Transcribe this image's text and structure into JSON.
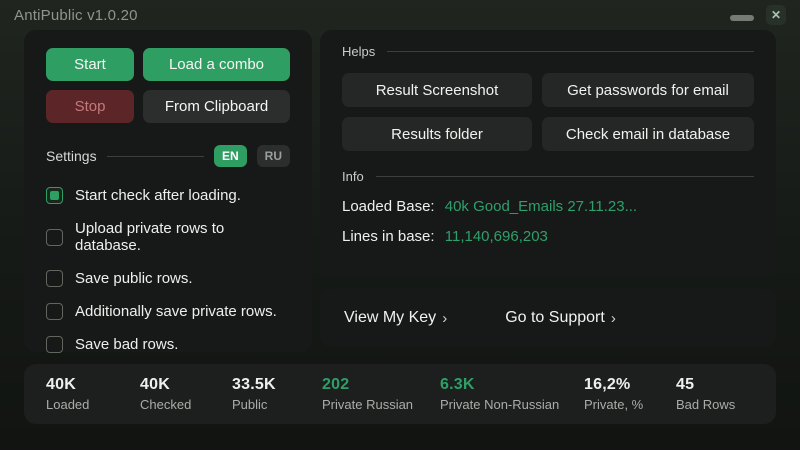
{
  "window": {
    "title": "AntiPublic v1.0.20",
    "close_glyph": "✕"
  },
  "left_panel": {
    "buttons": {
      "start": "Start",
      "load_combo": "Load a combo",
      "stop": "Stop",
      "from_clipboard": "From Clipboard"
    },
    "settings": {
      "label": "Settings",
      "languages": [
        {
          "code": "EN",
          "active": true
        },
        {
          "code": "RU",
          "active": false
        }
      ]
    },
    "checkboxes": [
      {
        "label": "Start check after loading.",
        "checked": true
      },
      {
        "label": "Upload private rows to database.",
        "checked": false
      },
      {
        "label": "Save public rows.",
        "checked": false
      },
      {
        "label": "Additionally save private rows.",
        "checked": false
      },
      {
        "label": "Save bad rows.",
        "checked": false
      }
    ]
  },
  "right_panel": {
    "helps": {
      "title": "Helps",
      "buttons": [
        "Result Screenshot",
        "Get passwords for email",
        "Results folder",
        "Check email in database"
      ]
    },
    "info": {
      "title": "Info",
      "rows": [
        {
          "label": "Loaded Base:",
          "value": "40k Good_Emails 27.11.23..."
        },
        {
          "label": "Lines in base:",
          "value": "11,140,696,203"
        }
      ]
    },
    "links": [
      {
        "label": "View My Key",
        "chevron": "›"
      },
      {
        "label": "Go to Support",
        "chevron": "›"
      }
    ]
  },
  "stats": [
    {
      "value": "40K",
      "label": "Loaded",
      "color": "white"
    },
    {
      "value": "40K",
      "label": "Checked",
      "color": "white"
    },
    {
      "value": "33.5K",
      "label": "Public",
      "color": "white"
    },
    {
      "value": "202",
      "label": "Private Russian",
      "color": "green"
    },
    {
      "value": "6.3K",
      "label": "Private Non-Russian",
      "color": "green"
    },
    {
      "value": "16,2%",
      "label": "Private, %",
      "color": "white"
    },
    {
      "value": "45",
      "label": "Bad Rows",
      "color": "white"
    }
  ],
  "colors": {
    "accent_green": "#2f9e63",
    "green_text": "#2f9f6b",
    "stop_bg": "#5c2628",
    "stop_text": "#c4797c",
    "panel_bg": "#171918"
  }
}
